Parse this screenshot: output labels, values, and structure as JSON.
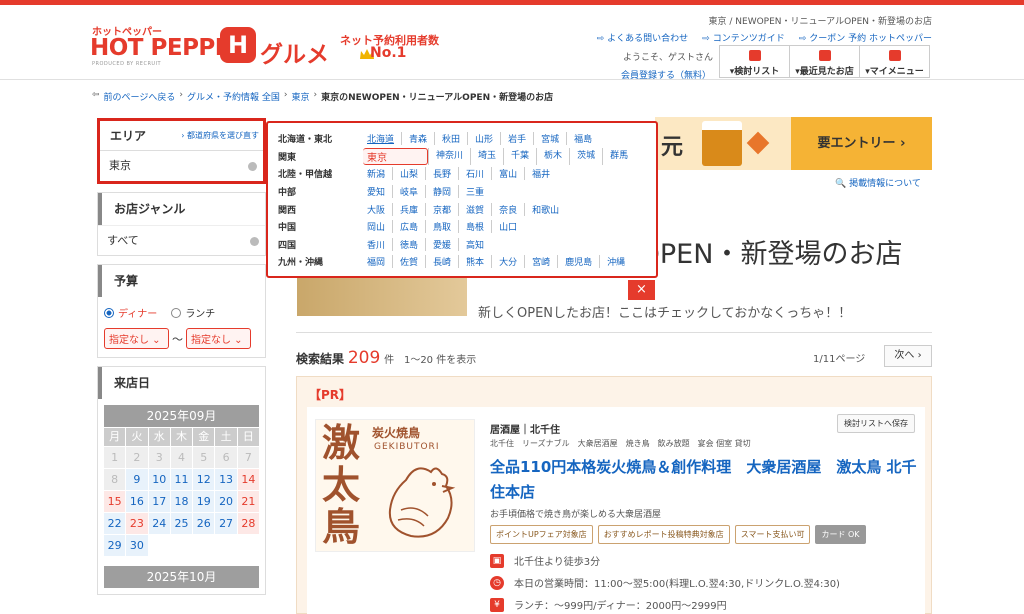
{
  "header": {
    "logo_small": "ホットペッパー",
    "logo_main": "HOT PEPPER",
    "logo_sub": "PRODUCED BY RECRUIT",
    "logo_h": "H",
    "logo_gourmet": "グルメ",
    "users_label": "ネット予約利用者数",
    "users_rank": "No.1",
    "breadcrumb_right": "東京 / NEWOPEN・リニューアルOPEN・新登場のお店",
    "links": [
      "よくある問い合わせ",
      "コンテンツガイド",
      "クーポン 予約 ホットペッパー"
    ],
    "welcome": "ようこそ、ゲストさん",
    "register": "会員登録する（無料）",
    "buttons": [
      "▾検討リスト",
      "▾最近見たお店",
      "▾マイメニュー"
    ]
  },
  "breadcrumb": {
    "back": "前のページへ戻る",
    "items": [
      "グルメ・予約情報 全国",
      "東京"
    ],
    "current": "東京のNEWOPEN・リニューアルOPEN・新登場のお店"
  },
  "sidebar": {
    "area_title": "エリア",
    "area_select": "都道府県を選び直す",
    "area_value": "東京",
    "genre_title": "お店ジャンル",
    "genre_value": "すべて",
    "budget_title": "予算",
    "dinner": "ディナー",
    "lunch": "ランチ",
    "budget_min": "指定なし",
    "budget_max": "指定なし",
    "tilde": "〜",
    "date_title": "来店日",
    "month1": "2025年09月",
    "month2": "2025年10月",
    "weekdays": [
      "月",
      "火",
      "水",
      "木",
      "金",
      "土",
      "日"
    ],
    "days": [
      "1",
      "2",
      "3",
      "4",
      "5",
      "6",
      "7",
      "8",
      "9",
      "10",
      "11",
      "12",
      "13",
      "14",
      "15",
      "16",
      "17",
      "18",
      "19",
      "20",
      "21",
      "22",
      "23",
      "24",
      "25",
      "26",
      "27",
      "28",
      "29",
      "30"
    ]
  },
  "banner": {
    "yen": "元",
    "entry": "要エントリー ›",
    "posting": "掲載情報について"
  },
  "hero": {
    "title": "リニューアルOPEN・新登場のお店",
    "subtitle": "新しくOPENしたお店！ここはチェックしておかなくっちゃ！！",
    "close": "×"
  },
  "results": {
    "label": "検索結果",
    "count": "209",
    "unit": "件",
    "range": "1〜20 件を表示",
    "page": "1/11ページ",
    "next": "次へ ›"
  },
  "card": {
    "pr": "【PR】",
    "save": "検討リストへ保存",
    "img_kanji": "激太鳥",
    "img_small": "炭火焼鳥",
    "img_en": "GEKIBUTORI",
    "category": "居酒屋｜北千住",
    "tags": "北千住　リーズナブル　大衆居酒屋　焼き鳥　飲み放題　宴会 個室 貸切",
    "name": "全品110円本格炭火焼鳥＆創作料理　大衆居酒屋　激太鳥 北千住本店",
    "catch": "お手頃価格で焼き鳥が楽しめる大衆居酒屋",
    "badges": [
      "ポイントUPフェア対象店",
      "おすすめレポート投稿特典対象店",
      "スマート支払い可",
      "カード OK"
    ],
    "access": "北千住より徒歩3分",
    "hours": "本日の営業時間：11:00〜翌5:00(料理L.O.翌4:30,ドリンクL.O.翌4:30)",
    "price": "ランチ：〜999円/ディナー：2000円〜2999円"
  },
  "popup": {
    "rows": [
      {
        "region": "北海道・東北",
        "prefs": [
          "北海道",
          "青森",
          "秋田",
          "山形",
          "岩手",
          "宮城",
          "福島"
        ]
      },
      {
        "region": "関東",
        "prefs": [
          "東京",
          "神奈川",
          "埼玉",
          "千葉",
          "栃木",
          "茨城",
          "群馬"
        ]
      },
      {
        "region": "北陸・甲信越",
        "prefs": [
          "新潟",
          "山梨",
          "長野",
          "石川",
          "富山",
          "福井"
        ]
      },
      {
        "region": "中部",
        "prefs": [
          "愛知",
          "岐阜",
          "静岡",
          "三重"
        ]
      },
      {
        "region": "関西",
        "prefs": [
          "大阪",
          "兵庫",
          "京都",
          "滋賀",
          "奈良",
          "和歌山"
        ]
      },
      {
        "region": "中国",
        "prefs": [
          "岡山",
          "広島",
          "鳥取",
          "島根",
          "山口"
        ]
      },
      {
        "region": "四国",
        "prefs": [
          "香川",
          "徳島",
          "愛媛",
          "高知"
        ]
      },
      {
        "region": "九州・沖縄",
        "prefs": [
          "福岡",
          "佐賀",
          "長崎",
          "熊本",
          "大分",
          "宮崎",
          "鹿児島",
          "沖縄"
        ]
      }
    ]
  }
}
